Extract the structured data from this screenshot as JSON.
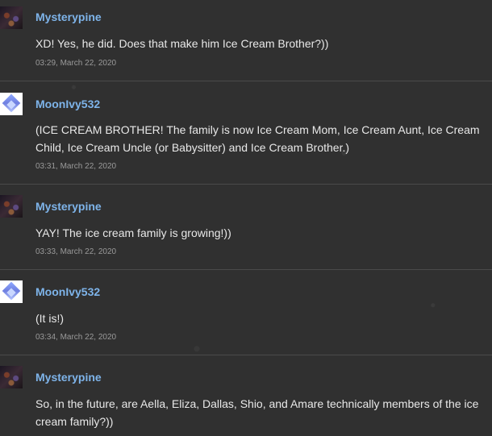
{
  "comments": [
    {
      "username": "Mysterypine",
      "avatar": "mysterypine-avatar",
      "text": "XD! Yes, he did. Does that make him Ice Cream Brother?))",
      "time": "03:29, March 22, 2020"
    },
    {
      "username": "MoonIvy532",
      "avatar": "moonivy-avatar",
      "text": "(ICE CREAM BROTHER! The family is now Ice Cream Mom, Ice Cream Aunt, Ice Cream Child, Ice Cream Uncle (or Babysitter) and Ice Cream Brother.)",
      "time": "03:31, March 22, 2020"
    },
    {
      "username": "Mysterypine",
      "avatar": "mysterypine-avatar",
      "text": "YAY! The ice cream family is growing!))",
      "time": "03:33, March 22, 2020"
    },
    {
      "username": "MoonIvy532",
      "avatar": "moonivy-avatar",
      "text": "(It is!)",
      "time": "03:34, March 22, 2020"
    },
    {
      "username": "Mysterypine",
      "avatar": "mysterypine-avatar",
      "text": "So, in the future, are Aella, Eliza, Dallas, Shio, and Amare technically members of the ice cream family?))",
      "time": ""
    }
  ]
}
